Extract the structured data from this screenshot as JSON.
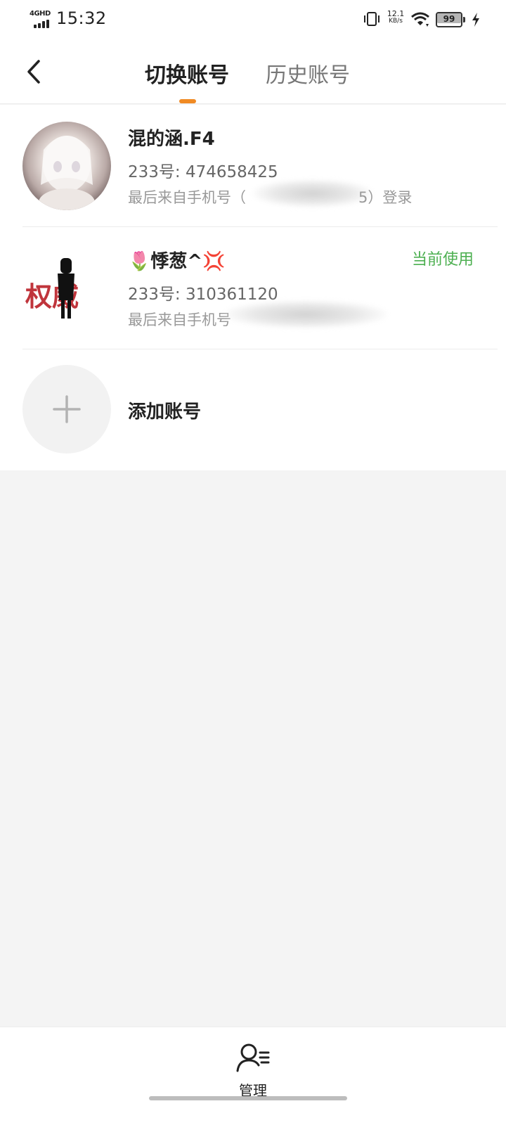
{
  "status_bar": {
    "network": "4GHD",
    "time": "15:32",
    "speed_value": "12.1",
    "speed_unit": "KB/s",
    "battery": "99",
    "battery_level": 0.99,
    "icons": [
      "signal-icon",
      "vibrate-icon",
      "wifi-icon",
      "battery-icon",
      "charging-icon"
    ]
  },
  "header": {
    "back_icon": "chevron-left-icon",
    "tabs": [
      {
        "label": "切换账号",
        "active": true
      },
      {
        "label": "历史账号",
        "active": false
      }
    ],
    "indicator_color": "#f08a24"
  },
  "accounts": [
    {
      "name": "混的涵.F4",
      "id_line": "233号: 474658425",
      "last_login_prefix": "最后来自手机号（",
      "last_login_suffix": "5）登录",
      "current_label": ""
    },
    {
      "name": "🌷悸葱^💢",
      "id_line": "233号: 310361120",
      "last_login_prefix": "最后来自手机号",
      "last_login_suffix": "",
      "current_label": "当前使用"
    }
  ],
  "add_account": {
    "label": "添加账号",
    "icon": "plus-icon"
  },
  "bottom_bar": {
    "manage_label": "管理",
    "manage_icon": "user-list-icon"
  },
  "colors": {
    "accent": "#f08a24",
    "current": "#4caf50",
    "background": "#f4f4f4"
  }
}
